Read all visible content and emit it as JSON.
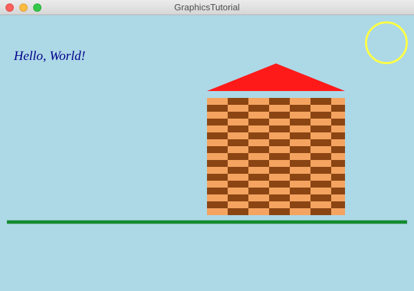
{
  "window": {
    "title": "GraphicsTutorial"
  },
  "scene": {
    "greeting": "Hello, World!",
    "colors": {
      "sky": "#add8e6",
      "greeting_text": "#00008b",
      "sun_outline": "#ffff44",
      "roof": "#ff1a1a",
      "brick_light": "#f4a460",
      "brick_dark": "#8b4513",
      "ground": "#138a2e"
    }
  }
}
